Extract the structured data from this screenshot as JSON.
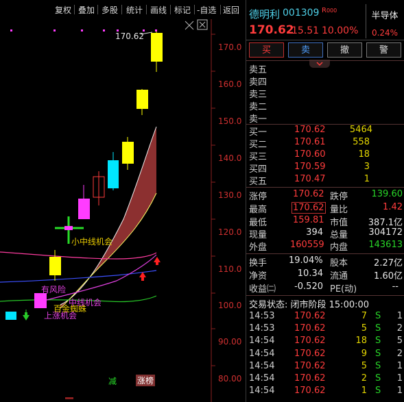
{
  "toolbar": {
    "items": [
      "复权",
      "叠加",
      "多股",
      "统计",
      "画线",
      "标记",
      "-自选",
      "返回"
    ]
  },
  "chart": {
    "price_labels": [
      "170.0",
      "160.0",
      "150.0",
      "140.0",
      "130.0",
      "120.0",
      "110.0",
      "100.0",
      "90.00",
      "80.00"
    ],
    "high_label": "170.62",
    "annotations": {
      "xiaozhong": "小中线机会",
      "youfengxian": "有风险",
      "zhongxian": "中线机会",
      "shangzhang": "上涨机会",
      "bai": "百",
      "jinzhizhu": "金蜘蛛",
      "jian": "减",
      "zhangbang": "涨榜"
    }
  },
  "stock": {
    "name": "德明利",
    "code": "001309",
    "tag": "R",
    "tag_sub": "000",
    "sector": "半导体",
    "sector_pct": "0.24%",
    "price": "170.62",
    "change": "15.51",
    "change_pct": "10.00%"
  },
  "actions": {
    "buy": "买",
    "sell": "卖",
    "cancel": "撤",
    "alert": "警"
  },
  "order_book": {
    "asks": [
      {
        "label": "卖五",
        "price": "",
        "vol": ""
      },
      {
        "label": "卖四",
        "price": "",
        "vol": ""
      },
      {
        "label": "卖三",
        "price": "",
        "vol": ""
      },
      {
        "label": "卖二",
        "price": "",
        "vol": ""
      },
      {
        "label": "卖一",
        "price": "",
        "vol": ""
      }
    ],
    "bids": [
      {
        "label": "买一",
        "price": "170.62",
        "vol": "5464"
      },
      {
        "label": "买二",
        "price": "170.61",
        "vol": "558"
      },
      {
        "label": "买三",
        "price": "170.60",
        "vol": "18"
      },
      {
        "label": "买四",
        "price": "170.59",
        "vol": "3"
      },
      {
        "label": "买五",
        "price": "170.47",
        "vol": "1"
      }
    ]
  },
  "stats": {
    "zhangting_l": "涨停",
    "zhangting": "170.62",
    "dieting_l": "跌停",
    "dieting": "139.60",
    "zuigao_l": "最高",
    "zuigao": "170.62",
    "liangbi_l": "量比",
    "liangbi": "1.42",
    "zuidi_l": "最低",
    "zuidi": "159.81",
    "shizhi_l": "市值",
    "shizhi": "387.1亿",
    "xianliang_l": "现量",
    "xianliang": "394",
    "zongliang_l": "总量",
    "zongliang": "304172",
    "waipan_l": "外盘",
    "waipan": "160559",
    "neipan_l": "内盘",
    "neipan": "143613",
    "huanshou_l": "换手",
    "huanshou": "19.04%",
    "guben_l": "股本",
    "guben": "2.27亿",
    "jingzi_l": "净资",
    "jingzi": "10.34",
    "liutong_l": "流通",
    "liutong": "1.60亿",
    "shouyi_l": "收益㈡",
    "shouyi": "-0.520",
    "pe_l": "PE(动)",
    "pe": "--"
  },
  "trade_status": "交易状态: 闭市阶段 15:00:00",
  "ticks": [
    {
      "time": "14:53",
      "price": "170.62",
      "vol": "7",
      "side": "S",
      "n": "1"
    },
    {
      "time": "14:53",
      "price": "170.62",
      "vol": "5",
      "side": "S",
      "n": "2"
    },
    {
      "time": "14:54",
      "price": "170.62",
      "vol": "18",
      "side": "S",
      "n": "5"
    },
    {
      "time": "14:54",
      "price": "170.62",
      "vol": "9",
      "side": "S",
      "n": "2"
    },
    {
      "time": "14:54",
      "price": "170.62",
      "vol": "5",
      "side": "S",
      "n": "1"
    },
    {
      "time": "14:54",
      "price": "170.62",
      "vol": "2",
      "side": "S",
      "n": "1"
    },
    {
      "time": "14:54",
      "price": "170.62",
      "vol": "1",
      "side": "S",
      "n": "1"
    }
  ]
}
